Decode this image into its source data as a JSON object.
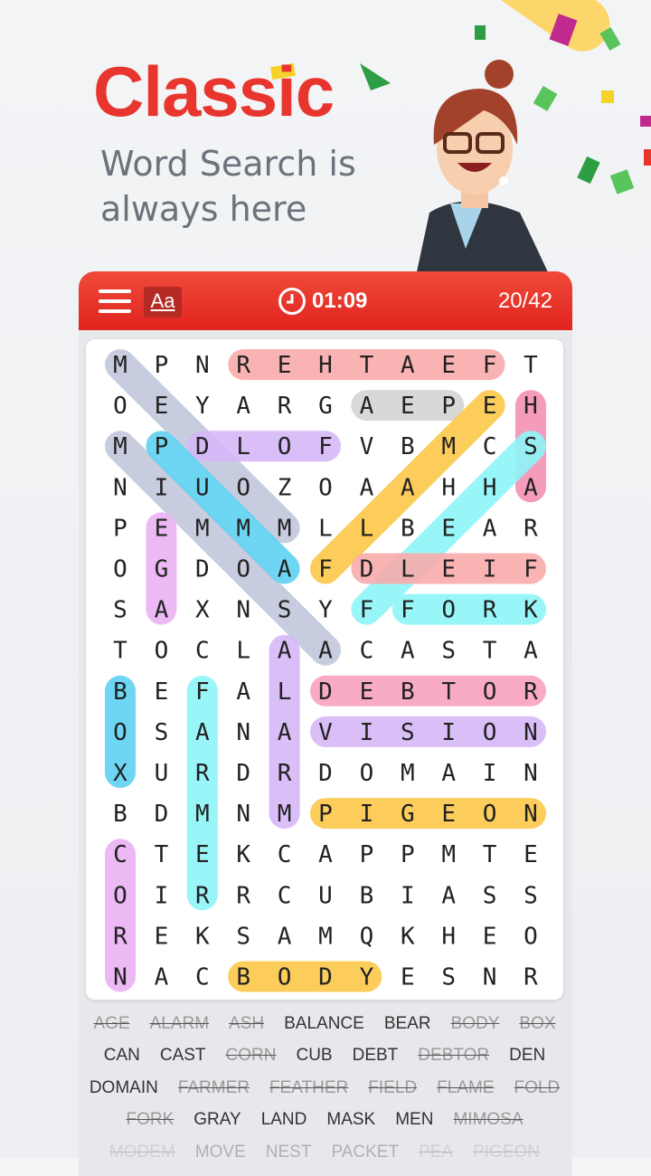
{
  "promo": {
    "title": "Classic",
    "subtitle_line1": "Word Search is",
    "subtitle_line2": "always here"
  },
  "toolbar": {
    "menu_icon": "hamburger-icon",
    "font_button_label": "Aa",
    "timer_icon": "clock-icon",
    "timer": "01:09",
    "progress": "20/42",
    "color": "#e8352d"
  },
  "grid": {
    "rows": [
      "MPNREHTAEFT",
      "OEYARGAEPEH",
      "MPDLOFVBMCS",
      "NIUOZOAAHHA",
      "PEMMMLLBEAR",
      "OGDOAFDLEIF",
      "SAXNSYFFORK",
      "TOCLAACASTA",
      "BEFALDEBTOR",
      "OSANAVISION",
      "XURDRDOMAIN",
      "BDMNMPIGEON",
      "CTEKCAPPMTE",
      "OIRRCUBIASS",
      "REKSAMQKHEO",
      "NACBODYESNR"
    ],
    "found": [
      {
        "word": "MODEM",
        "start": [
          0,
          0
        ],
        "end": [
          4,
          4
        ],
        "color": "#c3c7dc"
      },
      {
        "word": "MIMOSA",
        "start": [
          2,
          0
        ],
        "end": [
          7,
          5
        ],
        "color": "#c3c7dc"
      },
      {
        "word": "FEATHER",
        "start": [
          0,
          9
        ],
        "end": [
          0,
          3
        ],
        "color": "#f9abab"
      },
      {
        "word": "PEA",
        "start": [
          1,
          8
        ],
        "end": [
          1,
          6
        ],
        "color": "#d4d4d4"
      },
      {
        "word": "ASH",
        "start": [
          3,
          10
        ],
        "end": [
          1,
          10
        ],
        "color": "#f492b6"
      },
      {
        "word": "FOLD",
        "start": [
          2,
          5
        ],
        "end": [
          2,
          2
        ],
        "color": "#d5b8f8"
      },
      {
        "word": "PUMA",
        "start": [
          2,
          1
        ],
        "end": [
          5,
          4
        ],
        "color": "#5fd2f2"
      },
      {
        "word": "FLAME",
        "start": [
          5,
          5
        ],
        "end": [
          1,
          9
        ],
        "color": "#fcc84a"
      },
      {
        "word": "SHELF",
        "start": [
          2,
          10
        ],
        "end": [
          6,
          6
        ],
        "color": "#8ef6f8"
      },
      {
        "word": "FIELD",
        "start": [
          5,
          10
        ],
        "end": [
          5,
          6
        ],
        "color": "#f9abab"
      },
      {
        "word": "FORK",
        "start": [
          6,
          7
        ],
        "end": [
          6,
          10
        ],
        "color": "#8ef6f8"
      },
      {
        "word": "AGE",
        "start": [
          6,
          1
        ],
        "end": [
          4,
          1
        ],
        "color": "#ebb2f4"
      },
      {
        "word": "ALARM",
        "start": [
          7,
          4
        ],
        "end": [
          11,
          4
        ],
        "color": "#d5b8f8"
      },
      {
        "word": "BOX",
        "start": [
          8,
          0
        ],
        "end": [
          10,
          0
        ],
        "color": "#5fd2f2"
      },
      {
        "word": "FARMER",
        "start": [
          8,
          2
        ],
        "end": [
          13,
          2
        ],
        "color": "#8ef6f8"
      },
      {
        "word": "DEBTOR",
        "start": [
          8,
          5
        ],
        "end": [
          8,
          10
        ],
        "color": "#f9a3c0"
      },
      {
        "word": "VISION",
        "start": [
          9,
          5
        ],
        "end": [
          9,
          10
        ],
        "color": "#d5b8f8"
      },
      {
        "word": "PIGEON",
        "start": [
          11,
          5
        ],
        "end": [
          11,
          10
        ],
        "color": "#fcc84a"
      },
      {
        "word": "CORN",
        "start": [
          12,
          0
        ],
        "end": [
          15,
          0
        ],
        "color": "#ebb2f4"
      },
      {
        "word": "BODY",
        "start": [
          15,
          3
        ],
        "end": [
          15,
          6
        ],
        "color": "#fcc84a"
      }
    ]
  },
  "word_list": [
    [
      {
        "t": "AGE",
        "f": true
      },
      {
        "t": "ALARM",
        "f": true
      },
      {
        "t": "ASH",
        "f": true
      },
      {
        "t": "BALANCE",
        "f": false
      },
      {
        "t": "BEAR",
        "f": false
      },
      {
        "t": "BODY",
        "f": true
      },
      {
        "t": "BOX",
        "f": true
      }
    ],
    [
      {
        "t": "CAN",
        "f": false
      },
      {
        "t": "CAST",
        "f": false
      },
      {
        "t": "CORN",
        "f": true
      },
      {
        "t": "CUB",
        "f": false
      },
      {
        "t": "DEBT",
        "f": false
      },
      {
        "t": "DEBTOR",
        "f": true
      },
      {
        "t": "DEN",
        "f": false
      }
    ],
    [
      {
        "t": "DOMAIN",
        "f": false
      },
      {
        "t": "FARMER",
        "f": true
      },
      {
        "t": "FEATHER",
        "f": true
      },
      {
        "t": "FIELD",
        "f": true
      },
      {
        "t": "FLAME",
        "f": true
      },
      {
        "t": "FOLD",
        "f": true
      }
    ],
    [
      {
        "t": "FORK",
        "f": true
      },
      {
        "t": "GRAY",
        "f": false
      },
      {
        "t": "LAND",
        "f": false
      },
      {
        "t": "MASK",
        "f": false
      },
      {
        "t": "MEN",
        "f": false
      },
      {
        "t": "MIMOSA",
        "f": true
      }
    ],
    [
      {
        "t": "MODEM",
        "f": true
      },
      {
        "t": "MOVE",
        "f": false
      },
      {
        "t": "NEST",
        "f": false
      },
      {
        "t": "PACKET",
        "f": false
      },
      {
        "t": "PEA",
        "f": true
      },
      {
        "t": "PIGEON",
        "f": true
      }
    ]
  ]
}
